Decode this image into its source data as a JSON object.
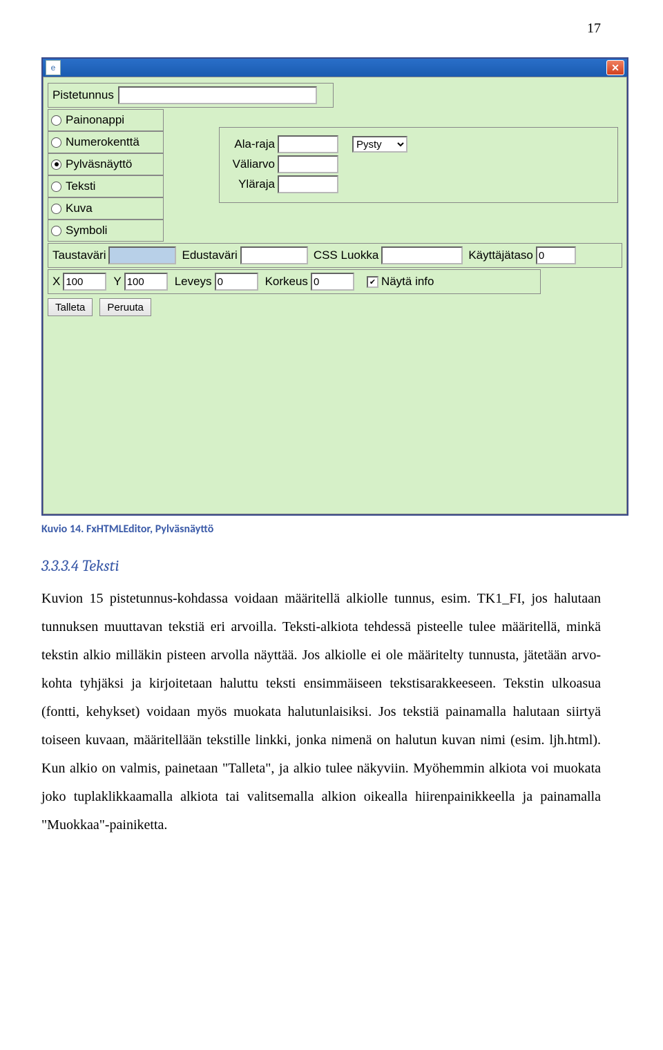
{
  "pageNumber": "17",
  "dialog": {
    "pistetunnus_label": "Pistetunnus",
    "pistetunnus_value": "",
    "radios": [
      "Painonappi",
      "Numerokenttä",
      "Pylväsnäyttö",
      "Teksti",
      "Kuva",
      "Symboli"
    ],
    "selectedRadioIndex": 2,
    "range": {
      "ala_label": "Ala-raja",
      "ala_value": "",
      "vali_label": "Väliarvo",
      "vali_value": "",
      "yla_label": "Yläraja",
      "yla_value": "",
      "orient_value": "Pysty"
    },
    "row3": {
      "taustavari_label": "Taustaväri",
      "taustavari_value": "",
      "edustavari_label": "Edustaväri",
      "edustavari_value": "",
      "css_label": "CSS Luokka",
      "css_value": "",
      "kayttajataso_label": "Käyttäjätaso",
      "kayttajataso_value": "0"
    },
    "row4": {
      "x_label": "X",
      "x_value": "100",
      "y_label": "Y",
      "y_value": "100",
      "leveys_label": "Leveys",
      "leveys_value": "0",
      "korkeus_label": "Korkeus",
      "korkeus_value": "0",
      "nayta_label": "Näytä info",
      "nayta_checked": true
    },
    "buttons": {
      "save": "Talleta",
      "cancel": "Peruuta"
    }
  },
  "caption": "Kuvio 14. FxHTMLEditor, Pylväsnäyttö",
  "heading": "3.3.3.4   Teksti",
  "paragraph": "Kuvion 15 pistetunnus-kohdassa voidaan määritellä alkiolle tunnus, esim. TK1_FI, jos halutaan tunnuksen muuttavan tekstiä eri arvoilla. Teksti-alkiota tehdessä pisteelle tulee määritellä, minkä tekstin alkio milläkin pisteen arvolla näyttää. Jos alkiolle ei ole määritelty tunnusta, jätetään arvo-kohta tyhjäksi ja kirjoitetaan haluttu teksti ensimmäiseen tekstisarakkeeseen. Tekstin ulkoasua (fontti, kehykset) voidaan myös muokata halutunlaisiksi. Jos tekstiä painamalla halutaan siirtyä toiseen kuvaan, määritellään tekstille linkki, jonka nimenä on halutun kuvan nimi (esim. ljh.html). Kun alkio on valmis, painetaan \"Talleta\", ja alkio tulee näkyviin. Myöhemmin alkiota voi muokata joko tuplaklikkaamalla alkiota tai valitsemalla alkion oikealla hiirenpainikkeella ja painamalla \"Muokkaa\"-painiketta."
}
